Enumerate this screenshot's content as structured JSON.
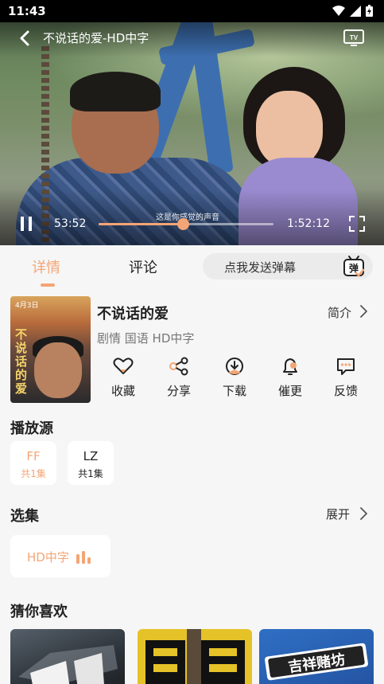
{
  "status_bar": {
    "time": "11:43"
  },
  "player": {
    "title": "不说话的爱-HD中字",
    "current_time": "53:52",
    "total_time": "1:52:12",
    "progress": 0.48,
    "subtitle": "这是你感觉的声音"
  },
  "tabs": {
    "detail": "详情",
    "comment": "评论",
    "danmaku_placeholder": "点我发送弹幕",
    "danmaku_icon_text": "弹"
  },
  "movie": {
    "title": "不说话的爱",
    "meta": "剧情 国语 HD中字",
    "intro_label": "简介",
    "poster_title": "不说话的爱",
    "poster_date": "4月3日"
  },
  "actions": [
    {
      "label": "收藏",
      "icon": "heart-icon"
    },
    {
      "label": "分享",
      "icon": "share-icon"
    },
    {
      "label": "下载",
      "icon": "download-icon"
    },
    {
      "label": "催更",
      "icon": "bell-icon"
    },
    {
      "label": "反馈",
      "icon": "feedback-icon"
    }
  ],
  "sources": {
    "title": "播放源",
    "items": [
      {
        "name": "FF",
        "count": "共1集",
        "active": true
      },
      {
        "name": "LZ",
        "count": "共1集",
        "active": false
      }
    ]
  },
  "episodes": {
    "title": "选集",
    "expand_label": "展开",
    "items": [
      {
        "label": "HD中字",
        "playing": true
      }
    ]
  },
  "recommend": {
    "title": "猜你喜欢",
    "items": [
      {
        "poster_text": ""
      },
      {
        "poster_text": ""
      },
      {
        "poster_text": "吉祥赌坊"
      }
    ]
  },
  "colors": {
    "accent": "#f4a575",
    "background": "#f6f6f6",
    "card": "#ffffff"
  }
}
